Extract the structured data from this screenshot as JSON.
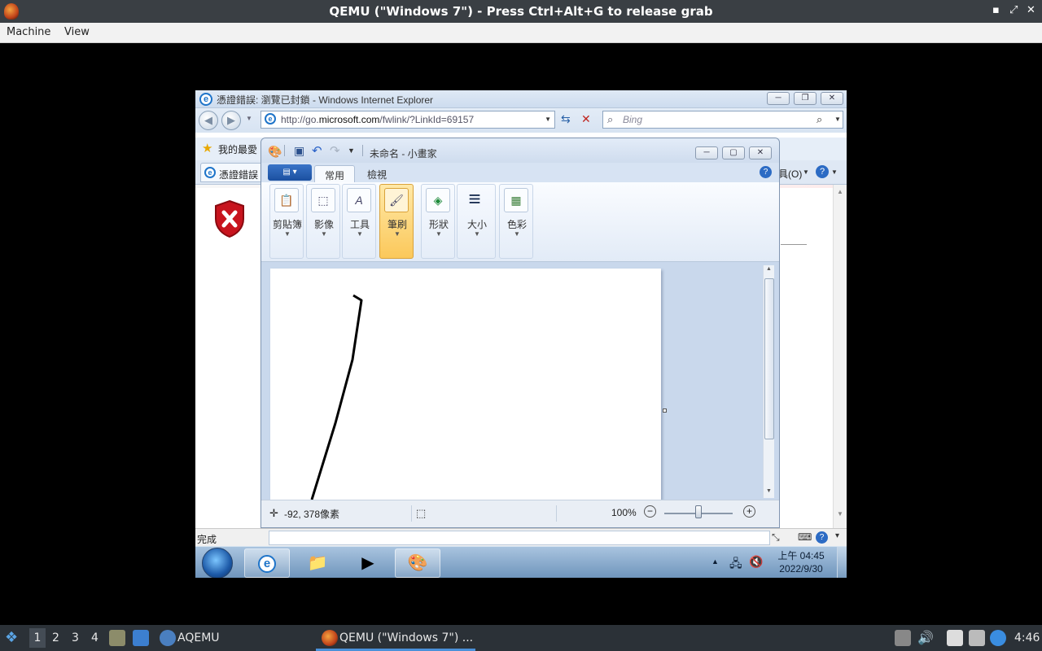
{
  "host": {
    "window_title": "QEMU (\"Windows 7\") - Press Ctrl+Alt+G to release grab",
    "menu": [
      "Machine",
      "View"
    ],
    "controls": [
      "▪",
      "⤢",
      "✕"
    ]
  },
  "ie": {
    "title": "憑證錯誤: 瀏覽已封鎖 - Windows Internet Explorer",
    "address_prefix": "http://go.",
    "address_host": "microsoft.com",
    "address_suffix": "/fwlink/?LinkId=69157",
    "search_placeholder": "Bing",
    "favorites_label": "我的最愛",
    "tab_label": "憑證錯誤",
    "tools_label": "具(O)",
    "status_text": "完成",
    "win_controls": [
      "─",
      "❐",
      "✕"
    ]
  },
  "paint": {
    "title": "未命名 - 小畫家",
    "tabs": [
      "常用",
      "檢視"
    ],
    "groups": [
      {
        "label": "剪貼簿",
        "icon": "📋"
      },
      {
        "label": "影像",
        "icon": "⬚"
      },
      {
        "label": "工具",
        "icon": "A"
      },
      {
        "label": "筆刷",
        "icon": "🖌"
      },
      {
        "label": "形狀",
        "icon": "◈"
      },
      {
        "label": "大小",
        "icon": "≡"
      },
      {
        "label": "色彩",
        "icon": "▦"
      }
    ],
    "status": {
      "cursor_pos": "-92, 378像素",
      "zoom": "100%",
      "zoom_level": 0.5
    },
    "win_controls": [
      "─",
      "▢",
      "✕"
    ]
  },
  "win7": {
    "clock_time": "上午 04:45",
    "clock_date": "2022/9/30"
  },
  "panel": {
    "workspaces": [
      "1",
      "2",
      "3",
      "4"
    ],
    "task_aqemu": "AQEMU",
    "task_qemu": "QEMU (\"Windows 7\") ...",
    "clock": "4:46"
  },
  "colors": {
    "host_title_bg": "#3a3f44",
    "panel_bg": "#2b3137",
    "brush_highlight": "#fbc85a",
    "ie_error_shield": "#c8141e"
  }
}
